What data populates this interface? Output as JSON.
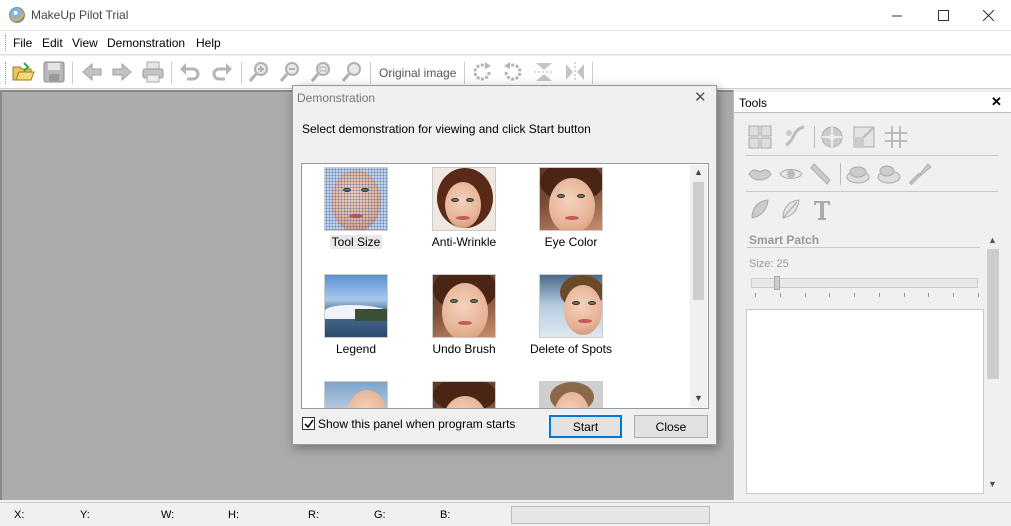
{
  "window": {
    "title": "MakeUp Pilot Trial"
  },
  "menu": {
    "items": [
      "File",
      "Edit",
      "View",
      "Demonstration",
      "Help"
    ]
  },
  "toolbar": {
    "original_image_label": "Original image"
  },
  "tools": {
    "title": "Tools",
    "patch_title": "Smart Patch",
    "size_label": "Size: 25",
    "size_value": 25
  },
  "status": {
    "x": "X:",
    "y": "Y:",
    "w": "W:",
    "h": "H:",
    "r": "R:",
    "g": "G:",
    "b": "B:"
  },
  "dialog": {
    "title": "Demonstration",
    "instruction": "Select demonstration for viewing and click Start button",
    "items": [
      {
        "label": "Tool Size",
        "selected": true
      },
      {
        "label": "Anti-Wrinkle"
      },
      {
        "label": "Eye Color"
      },
      {
        "label": "Legend"
      },
      {
        "label": "Undo Brush"
      },
      {
        "label": "Delete of Spots"
      }
    ],
    "show_panel_label": "Show this panel when program starts",
    "show_panel_checked": true,
    "start_label": "Start",
    "close_label": "Close"
  }
}
